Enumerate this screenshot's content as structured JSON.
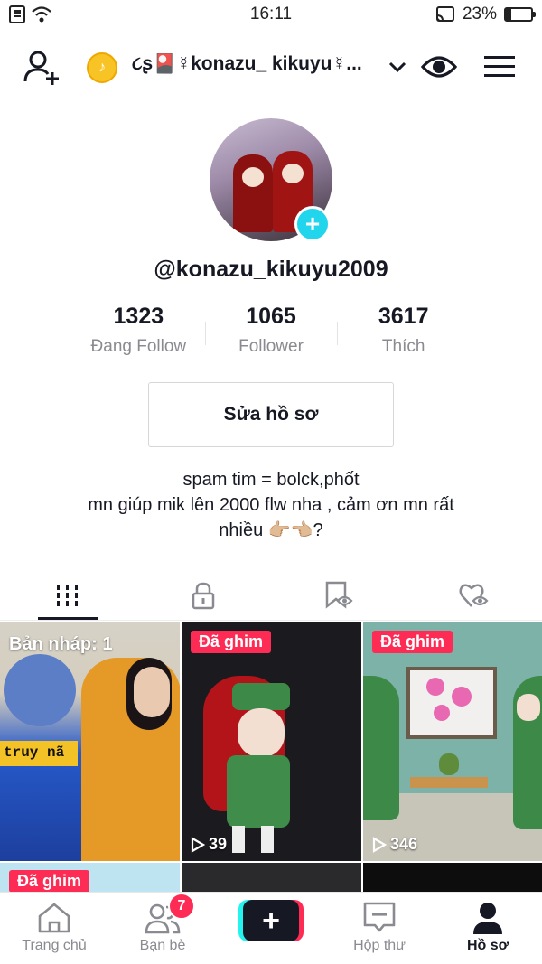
{
  "status_bar": {
    "time": "16:11",
    "battery_percent": "23%",
    "battery_level": 0.23
  },
  "top_bar": {
    "username": "૮ʂ🎴☿konazu_ kikuyu☿...",
    "icons": [
      "add-user-icon",
      "coin-icon",
      "chevron-down-icon",
      "eye-icon",
      "menu-icon"
    ]
  },
  "profile": {
    "handle": "@konazu_kikuyu2009",
    "stats": [
      {
        "value": "1323",
        "label": "Đang Follow"
      },
      {
        "value": "1065",
        "label": "Follower"
      },
      {
        "value": "3617",
        "label": "Thích"
      }
    ],
    "edit_button": "Sửa hồ sơ",
    "bio_line1": "spam tim = bolck,phốt",
    "bio_line2": "mn giúp mik lên 2000 flw nha , cảm ơn mn rất",
    "bio_line3": "nhiều 👉🏼👈🏼?"
  },
  "tabs": [
    {
      "icon": "grid-icon",
      "active": true
    },
    {
      "icon": "lock-icon",
      "active": false
    },
    {
      "icon": "bookmark-eye-icon",
      "active": false
    },
    {
      "icon": "heart-eye-icon",
      "active": false
    }
  ],
  "grid": {
    "draft_label": "Bản nháp: 1",
    "draft_caption": "truy nã",
    "pinned_label": "Đã ghim",
    "video2_views": "39",
    "video3_views": "346"
  },
  "bottom_nav": {
    "home": "Trang chủ",
    "friends": "Bạn bè",
    "friends_badge": "7",
    "create": "+",
    "inbox": "Hộp thư",
    "profile": "Hồ sơ"
  },
  "colors": {
    "accent_red": "#fe2c55",
    "accent_cyan": "#20d5ec",
    "text_primary": "#161823",
    "text_secondary": "#8a8b91"
  }
}
